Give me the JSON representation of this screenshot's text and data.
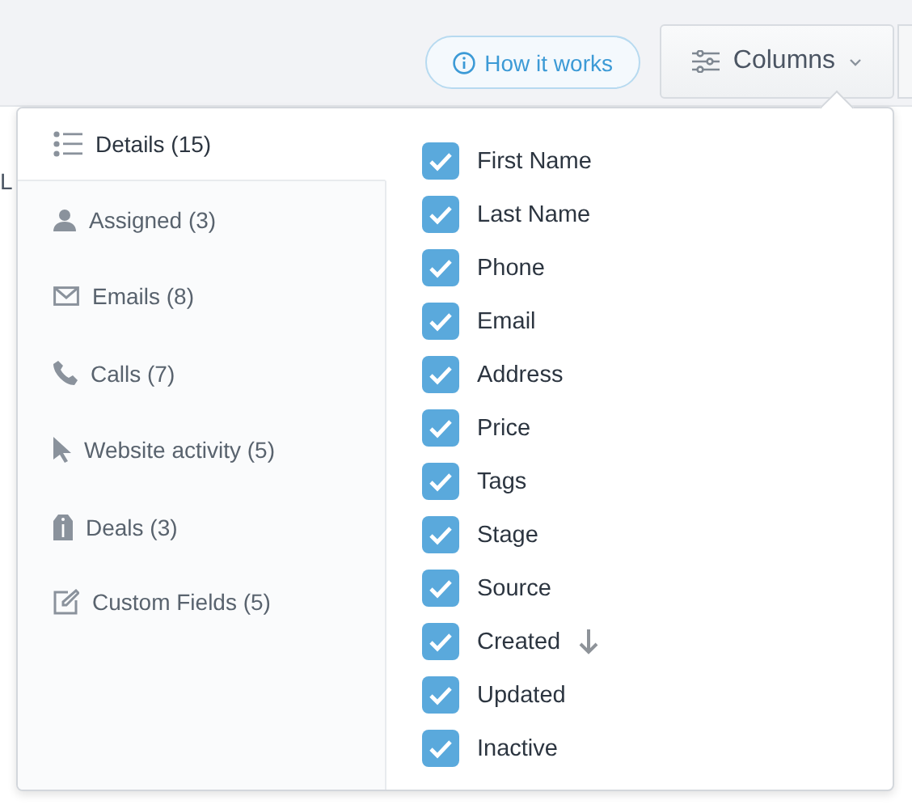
{
  "toolbar": {
    "help_button": "How it works",
    "columns_button": "Columns"
  },
  "background": {
    "column_header": "L"
  },
  "categories": [
    {
      "label": "Details (15)",
      "selected": true
    },
    {
      "label": "Assigned (3)",
      "selected": false
    },
    {
      "label": "Emails (8)",
      "selected": false
    },
    {
      "label": "Calls (7)",
      "selected": false
    },
    {
      "label": "Website activity (5)",
      "selected": false
    },
    {
      "label": "Deals (3)",
      "selected": false
    },
    {
      "label": "Custom Fields (5)",
      "selected": false
    }
  ],
  "fields": [
    {
      "label": "First Name",
      "checked": true,
      "sorted": false
    },
    {
      "label": "Last Name",
      "checked": true,
      "sorted": false
    },
    {
      "label": "Phone",
      "checked": true,
      "sorted": false
    },
    {
      "label": "Email",
      "checked": true,
      "sorted": false
    },
    {
      "label": "Address",
      "checked": true,
      "sorted": false
    },
    {
      "label": "Price",
      "checked": true,
      "sorted": false
    },
    {
      "label": "Tags",
      "checked": true,
      "sorted": false
    },
    {
      "label": "Stage",
      "checked": true,
      "sorted": false
    },
    {
      "label": "Source",
      "checked": true,
      "sorted": false
    },
    {
      "label": "Created",
      "checked": true,
      "sorted": true
    },
    {
      "label": "Updated",
      "checked": true,
      "sorted": false
    },
    {
      "label": "Inactive",
      "checked": true,
      "sorted": false
    }
  ]
}
